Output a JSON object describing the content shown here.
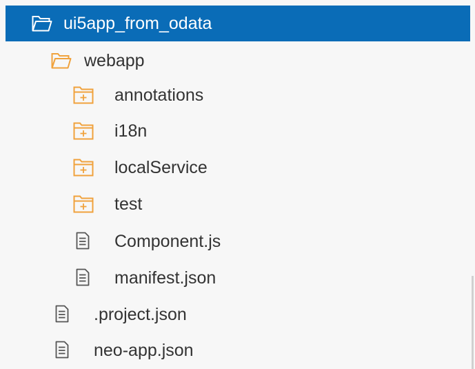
{
  "tree": {
    "root": {
      "label": "ui5app_from_odata",
      "icon": "folder-open-icon"
    },
    "webapp": {
      "label": "webapp",
      "icon": "folder-open-icon"
    },
    "folders": [
      {
        "label": "annotations",
        "icon": "folder-collapsed-icon"
      },
      {
        "label": "i18n",
        "icon": "folder-collapsed-icon"
      },
      {
        "label": "localService",
        "icon": "folder-collapsed-icon"
      },
      {
        "label": "test",
        "icon": "folder-collapsed-icon"
      }
    ],
    "webapp_files": [
      {
        "label": "Component.js",
        "icon": "file-icon"
      },
      {
        "label": "manifest.json",
        "icon": "file-icon"
      }
    ],
    "root_files": [
      {
        "label": ".project.json",
        "icon": "file-icon"
      },
      {
        "label": "neo-app.json",
        "icon": "file-icon"
      }
    ]
  },
  "colors": {
    "selection": "#0a6cb7",
    "folder": "#f0a23c",
    "file": "#555555",
    "text": "#333333"
  }
}
